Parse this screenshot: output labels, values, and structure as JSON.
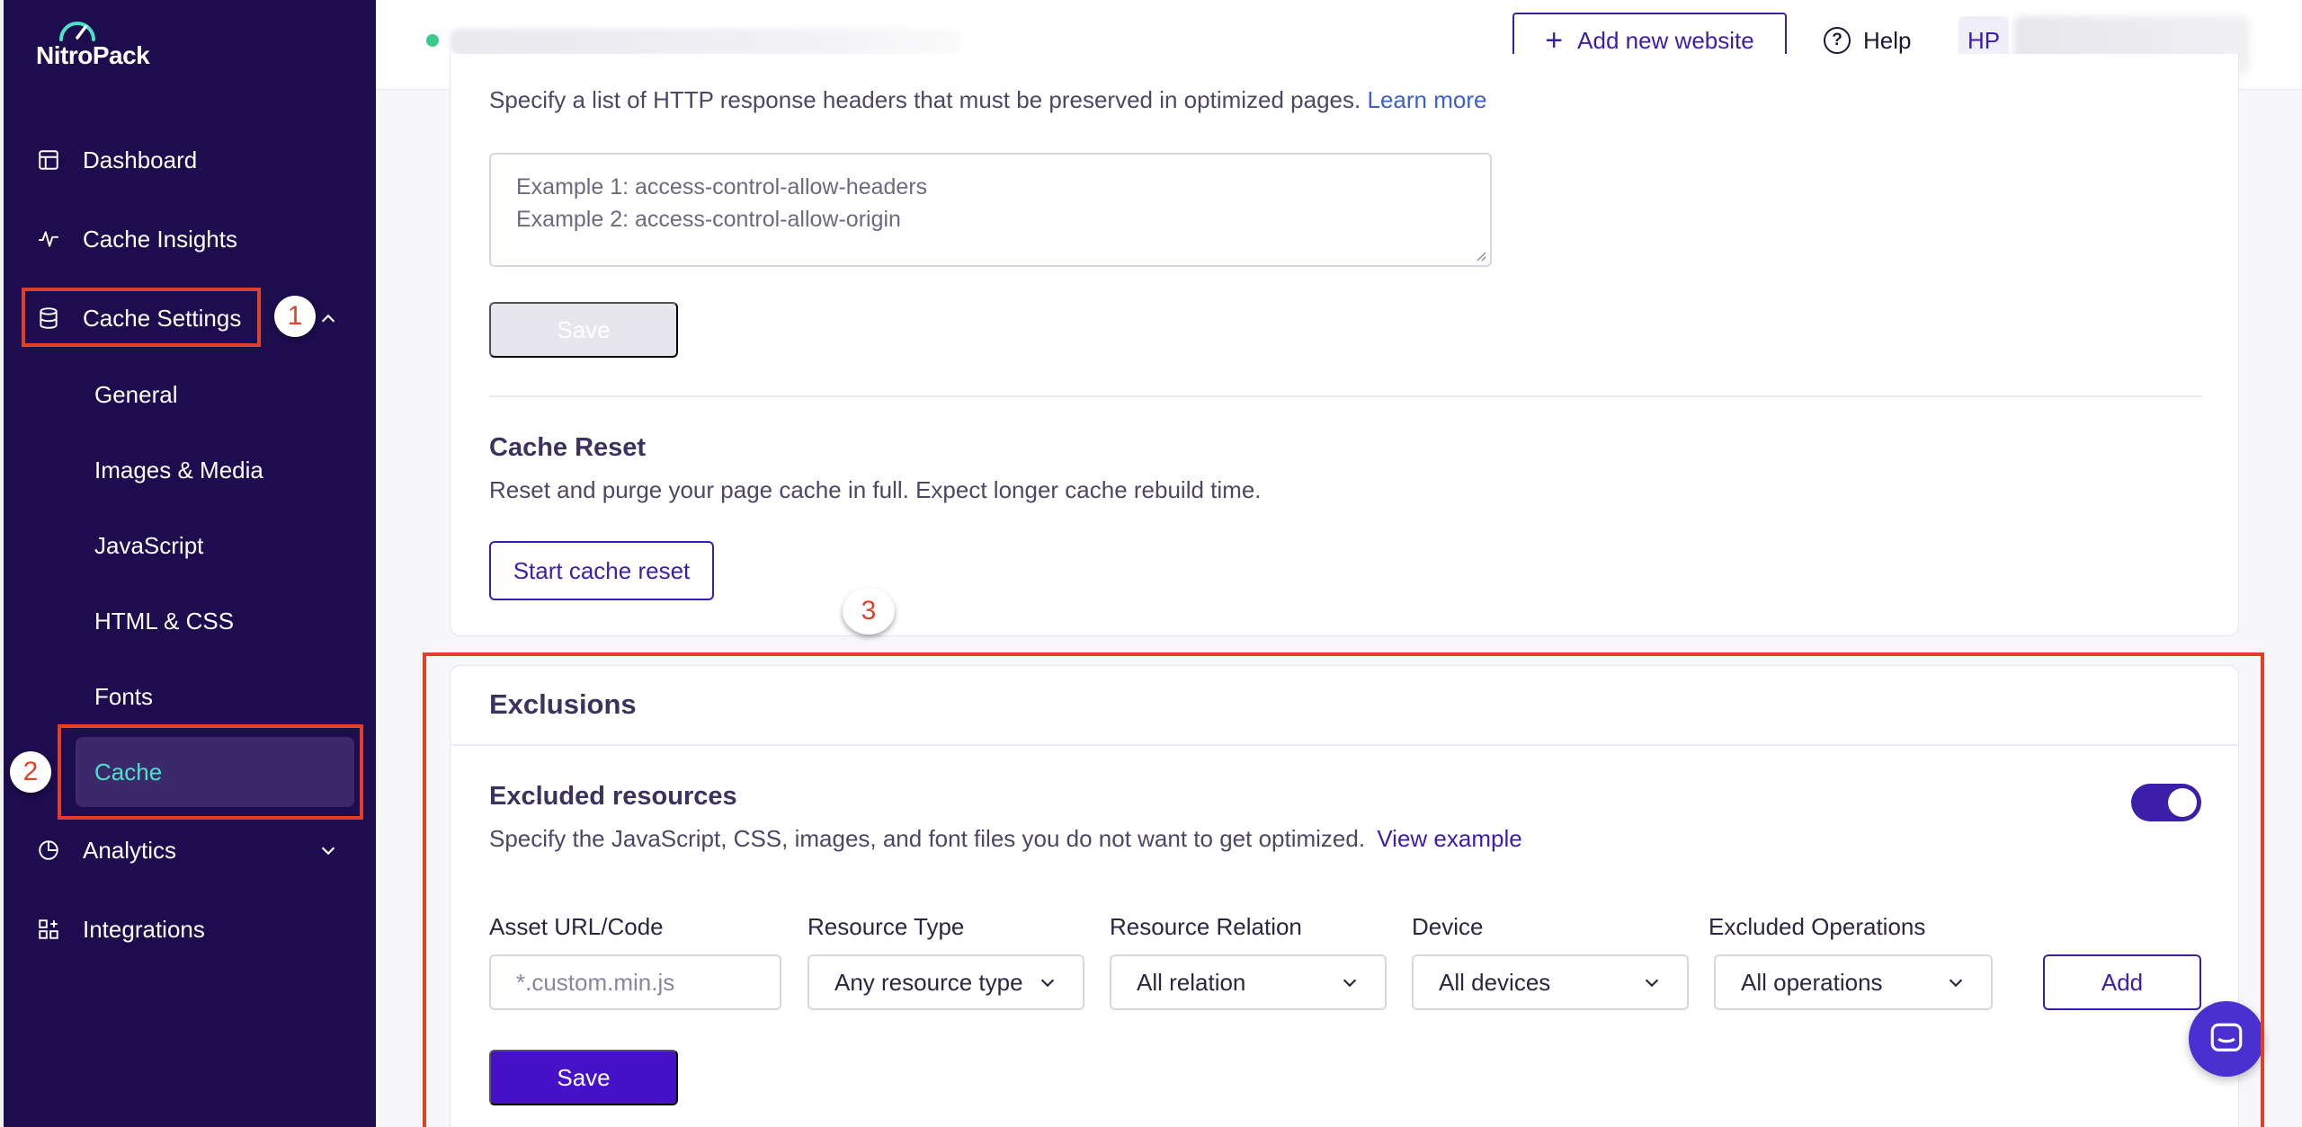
{
  "app": {
    "logo_text": "NitroPack",
    "accent_color": "#3c1fa8",
    "sidebar_color": "#1d0c4e"
  },
  "sidebar": {
    "items": [
      {
        "label": "Dashboard",
        "icon": "dashboard-icon"
      },
      {
        "label": "Cache Insights",
        "icon": "pulse-icon"
      },
      {
        "label": "Cache Settings",
        "icon": "database-icon"
      },
      {
        "label": "Analytics",
        "icon": "pie-chart-icon"
      },
      {
        "label": "Integrations",
        "icon": "grid-icon"
      }
    ],
    "subitems": [
      "General",
      "Images & Media",
      "JavaScript",
      "HTML & CSS",
      "Fonts",
      "Cache"
    ],
    "active_subitem": "Cache"
  },
  "annotations": [
    "1",
    "2",
    "3"
  ],
  "topbar": {
    "add_site_label": "Add new website",
    "help_label": "Help",
    "avatar_initials": "HP"
  },
  "headers_section": {
    "description": "Specify a list of HTTP response headers that must be preserved in optimized pages.",
    "learn_more": "Learn more",
    "textarea_line1": "Example 1: access-control-allow-headers",
    "textarea_line2": "Example 2: access-control-allow-origin",
    "save_label": "Save"
  },
  "cache_reset": {
    "title": "Cache Reset",
    "description": "Reset and purge your page cache in full. Expect longer cache rebuild time.",
    "button_label": "Start cache reset"
  },
  "exclusions": {
    "title": "Exclusions",
    "excluded_resources_title": "Excluded resources",
    "description": "Specify the JavaScript, CSS, images, and font files you do not want to get optimized.",
    "view_example": "View example",
    "toggle_on": true,
    "fields": {
      "asset_label": "Asset URL/Code",
      "asset_placeholder": "*.custom.min.js",
      "resource_type_label": "Resource Type",
      "resource_type_value": "Any resource type",
      "relation_label": "Resource Relation",
      "relation_value": "All relation",
      "device_label": "Device",
      "device_value": "All devices",
      "operations_label": "Excluded Operations",
      "operations_value": "All operations"
    },
    "add_label": "Add",
    "save_label": "Save"
  }
}
